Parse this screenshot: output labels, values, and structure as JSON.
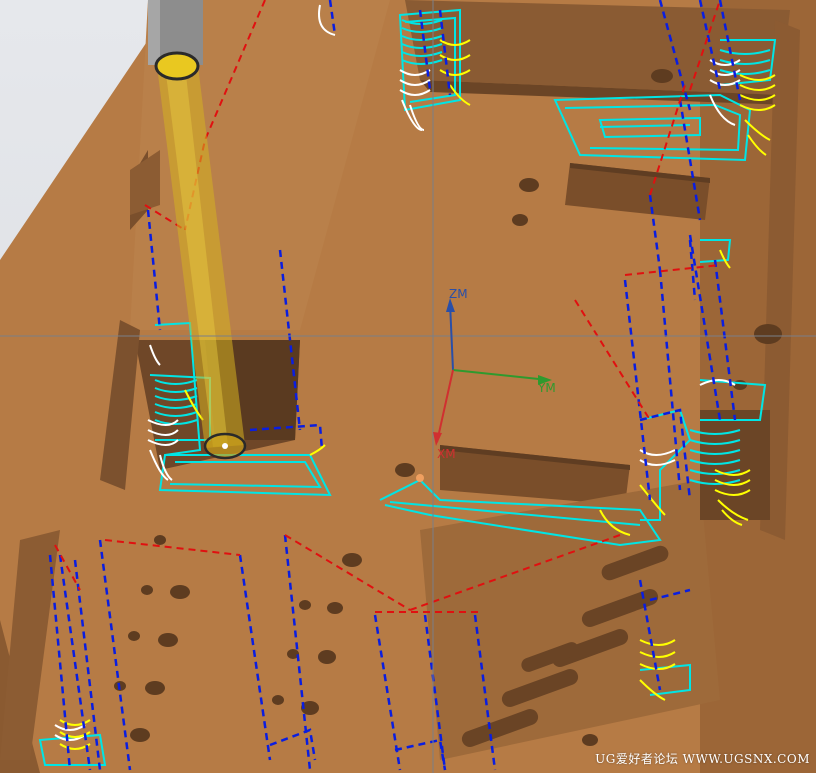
{
  "axes": {
    "z_label": "ZM",
    "y_label": "YM",
    "x_label": "XM"
  },
  "watermark": "UG爱好者论坛 WWW.UGSNX.COM",
  "colors": {
    "background": "#dcdfe4",
    "part_body": "#a4703f",
    "part_top": "#b57a45",
    "part_side": "#7b5230",
    "pocket": "#6b4526",
    "tool_shank": "#8a8a8a",
    "tool_holder": "#d6b020",
    "toolpath_cut": "#00e5e5",
    "toolpath_plunge": "#0a1ee0",
    "toolpath_rapid": "#e01010",
    "toolpath_yellow": "#ffff00",
    "toolpath_white": "#ffffff",
    "axis_z": "#2a4fa8",
    "axis_y": "#2e9a2e",
    "axis_x": "#d03030"
  }
}
